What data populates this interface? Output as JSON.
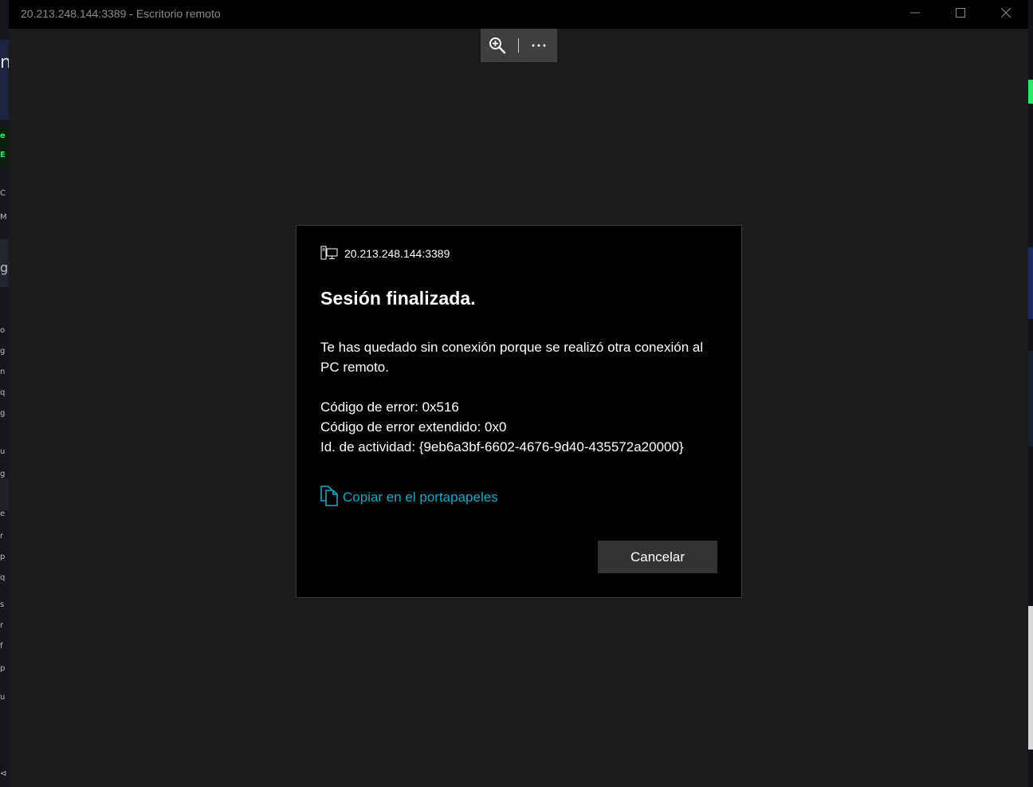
{
  "window": {
    "host": "20.213.248.144:3389",
    "separator": "-",
    "app_name": "Escritorio remoto"
  },
  "window_controls": {
    "minimize_icon": "minimize-icon",
    "maximize_icon": "maximize-icon",
    "close_icon": "close-icon"
  },
  "connection_bar": {
    "zoom_icon": "zoom-in-icon",
    "more_icon": "more-icon"
  },
  "dialog": {
    "host": "20.213.248.144:3389",
    "host_icon": "remote-pc-icon",
    "title": "Sesión finalizada.",
    "message": "Te has quedado sin conexión porque se realizó otra conexión al PC remoto.",
    "error_code": "Código de error: 0x516",
    "extended_error_code": "Código de error extendido: 0x0",
    "activity_id": "Id. de actividad: {9eb6a3bf-6602-4676-9d40-435572a20000}",
    "copy_link": "Copiar en el portapapeles",
    "copy_icon": "copy-icon",
    "cancel_button": "Cancelar"
  },
  "colors": {
    "link": "#19a7c8",
    "dialog_bg": "#000000",
    "window_bg": "#1b1b1b",
    "button_bg": "#333333"
  }
}
